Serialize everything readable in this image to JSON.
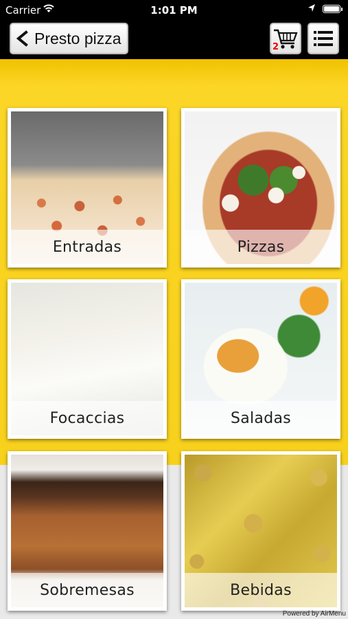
{
  "status_bar": {
    "carrier": "Carrier",
    "time": "1:01 PM"
  },
  "nav": {
    "back_label": "Presto pizza",
    "cart_count": "2"
  },
  "categories": [
    {
      "label": "Entradas"
    },
    {
      "label": "Pizzas"
    },
    {
      "label": "Focaccias"
    },
    {
      "label": "Saladas"
    },
    {
      "label": "Sobremesas"
    },
    {
      "label": "Bebidas"
    }
  ],
  "footer": {
    "powered_by": "Powered by AirMenu"
  },
  "colors": {
    "header_background": "#000000",
    "band_yellow": "#f9d31f",
    "lower_band_gray": "#e9e9e9",
    "cart_badge_red": "#e00000"
  },
  "icons": [
    "wifi-icon",
    "location-arrow-icon",
    "battery-icon",
    "back-chevron-icon",
    "cart-icon",
    "hamburger-menu-icon"
  ]
}
